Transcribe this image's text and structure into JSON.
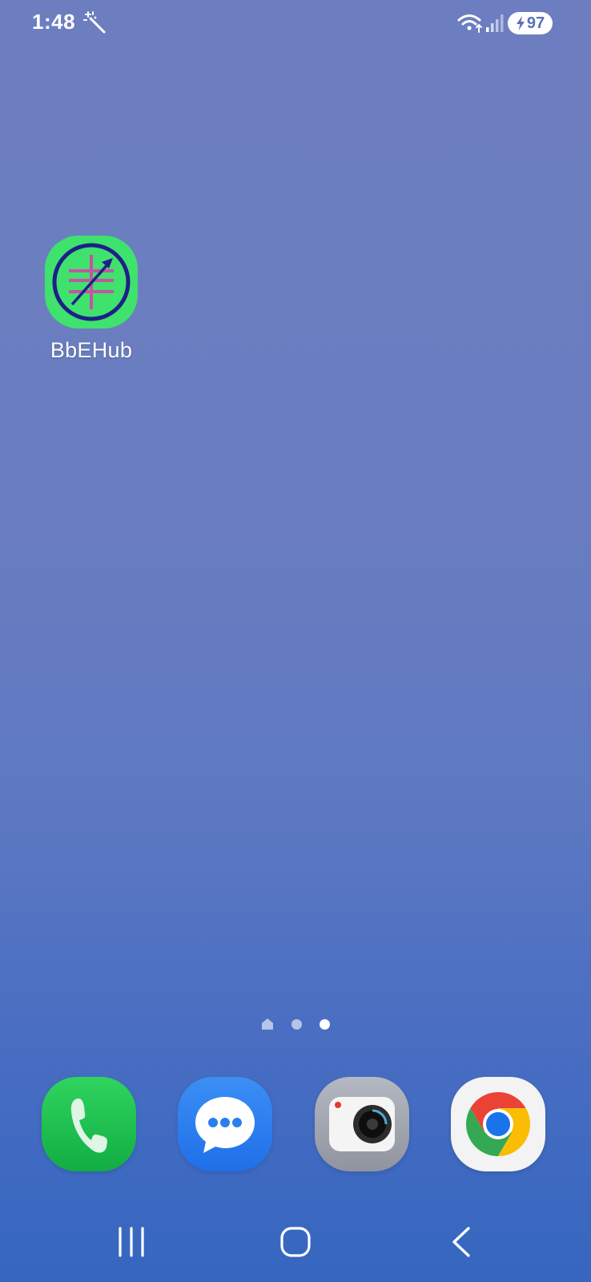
{
  "status_bar": {
    "time": "1:48",
    "battery_level": "97",
    "icons": [
      "magic-wand-icon",
      "wifi-icon",
      "cellular-signal-icon",
      "battery-charging-icon"
    ]
  },
  "home_screen": {
    "apps": [
      {
        "label": "BbEHub",
        "icon": "bbehub-app-icon"
      }
    ],
    "page_indicator": {
      "pages": [
        "home",
        "page",
        "page"
      ],
      "active_index": 2
    }
  },
  "dock": {
    "apps": [
      {
        "icon": "phone-app-icon"
      },
      {
        "icon": "messages-app-icon"
      },
      {
        "icon": "camera-app-icon"
      },
      {
        "icon": "chrome-app-icon"
      }
    ]
  },
  "navigation_bar": {
    "buttons": [
      "recents-icon",
      "home-icon",
      "back-icon"
    ]
  },
  "colors": {
    "wallpaper_top": "#6c7ec0",
    "wallpaper_bottom": "#3566c0",
    "bbehub_bg": "#3ee26c",
    "bbehub_ring": "#1f1f8a",
    "bbehub_bars": "#c554a4"
  }
}
